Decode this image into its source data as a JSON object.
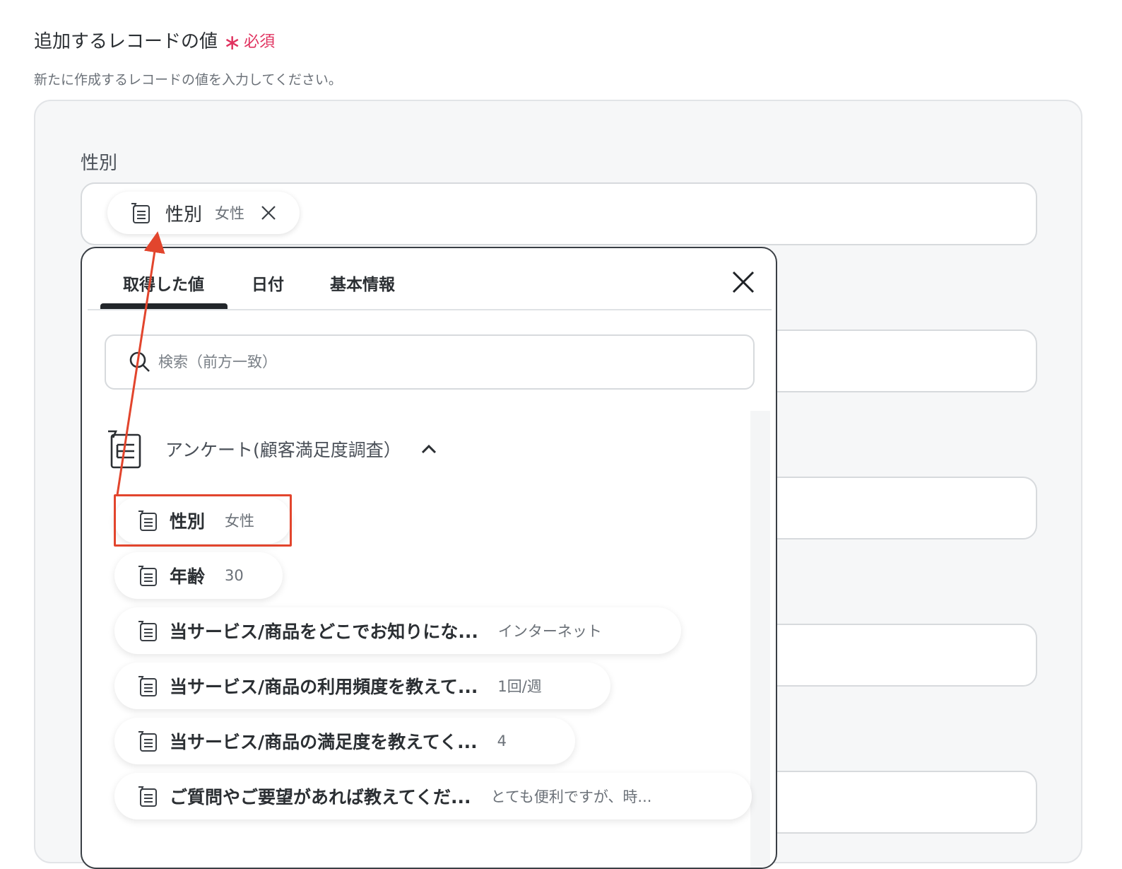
{
  "section": {
    "title": "追加するレコードの値",
    "required_label": "必須",
    "description": "新たに作成するレコードの値を入力してください。"
  },
  "field": {
    "label": "性別",
    "chip": {
      "label": "性別",
      "value": "女性",
      "icon": "form-icon"
    }
  },
  "popup": {
    "tabs": [
      "取得した値",
      "日付",
      "基本情報"
    ],
    "active_tab": "取得した値",
    "search_placeholder": "検索（前方一致）",
    "group": {
      "title": "アンケート(顧客満足度調査）",
      "expanded": true
    },
    "items": [
      {
        "label": "性別",
        "value": "女性"
      },
      {
        "label": "年齢",
        "value": "30"
      },
      {
        "label": "当サービス/商品をどこでお知りにな...",
        "value": "インターネット"
      },
      {
        "label": "当サービス/商品の利用頻度を教えて...",
        "value": "1回/週"
      },
      {
        "label": "当サービス/商品の満足度を教えてく...",
        "value": "4"
      },
      {
        "label": "ご質問やご要望があれば教えてくだ...",
        "value": "とても便利ですが、時..."
      }
    ]
  },
  "colors": {
    "required": "#e0325f",
    "highlight": "#e2452d",
    "arrow": "#e2452d"
  }
}
